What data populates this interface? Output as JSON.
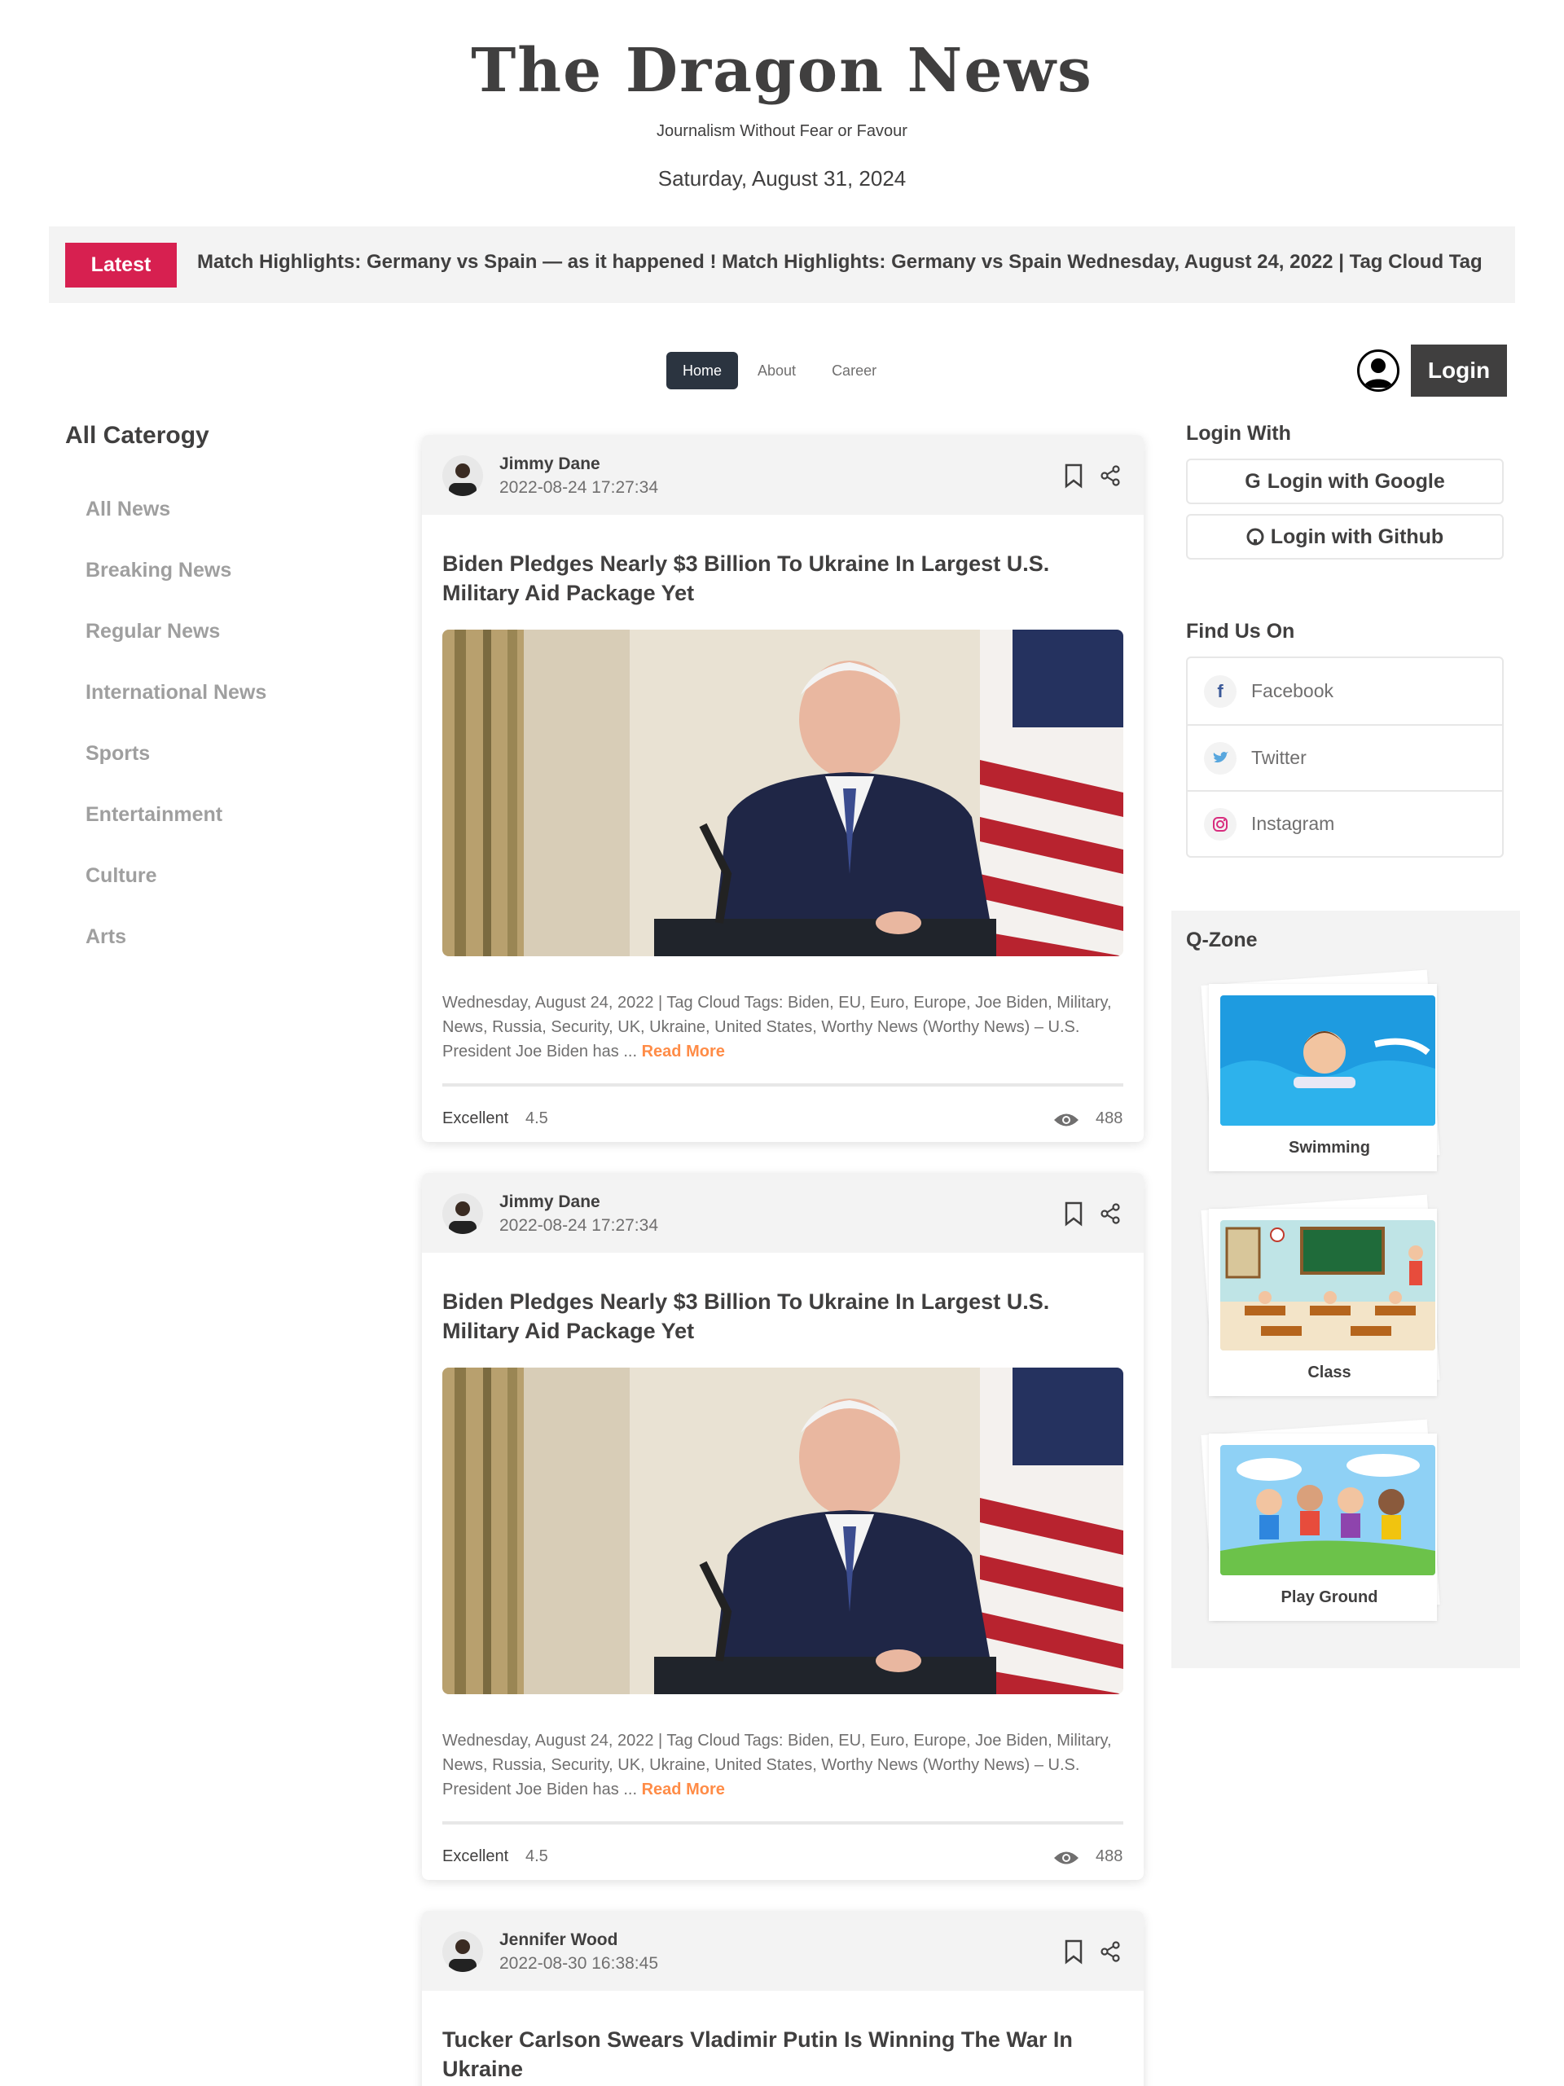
{
  "site": {
    "logo": "The Dragon News",
    "tagline": "Journalism Without Fear or Favour",
    "date": "Saturday, August 31, 2024"
  },
  "latest": {
    "badge": "Latest",
    "ticker": "Match Highlights: Germany vs Spain — as it happened ! Match Highlights: Germany vs Spain Wednesday, August 24, 2022 | Tag Cloud Tag"
  },
  "nav": {
    "items": [
      "Home",
      "About",
      "Career"
    ],
    "active": "Home",
    "login": "Login"
  },
  "categories": {
    "heading": "All Caterogy",
    "items": [
      "All News",
      "Breaking News",
      "Regular News",
      "International News",
      "Sports",
      "Entertainment",
      "Culture",
      "Arts"
    ]
  },
  "news": [
    {
      "author": "Jimmy Dane",
      "published": "2022-08-24 17:27:34",
      "title": "Biden Pledges Nearly $3 Billion To Ukraine In Largest U.S. Military Aid Package Yet",
      "excerpt": "Wednesday, August 24, 2022 | Tag Cloud Tags: Biden, EU, Euro, Europe, Joe Biden, Military, News, Russia, Security, UK, Ukraine, United States, Worthy News (Worthy News) – U.S. President Joe Biden has ...",
      "read_more": "Read More",
      "rating_label": "Excellent",
      "rating": "4.5",
      "views": "488"
    },
    {
      "author": "Jimmy Dane",
      "published": "2022-08-24 17:27:34",
      "title": "Biden Pledges Nearly $3 Billion To Ukraine In Largest U.S. Military Aid Package Yet",
      "excerpt": "Wednesday, August 24, 2022 | Tag Cloud Tags: Biden, EU, Euro, Europe, Joe Biden, Military, News, Russia, Security, UK, Ukraine, United States, Worthy News (Worthy News) – U.S. President Joe Biden has ...",
      "read_more": "Read More",
      "rating_label": "Excellent",
      "rating": "4.5",
      "views": "488"
    },
    {
      "author": "Jennifer Wood",
      "published": "2022-08-30 16:38:45",
      "title": "Tucker Carlson Swears Vladimir Putin Is Winning The War In Ukraine"
    }
  ],
  "login_with": {
    "heading": "Login With",
    "google": "Login with Google",
    "github": "Login with Github"
  },
  "find_us": {
    "heading": "Find Us On",
    "items": [
      "Facebook",
      "Twitter",
      "Instagram"
    ]
  },
  "qzone": {
    "heading": "Q-Zone",
    "items": [
      "Swimming",
      "Class",
      "Play Ground"
    ]
  },
  "colors": {
    "accent": "#d72050",
    "read_more": "#ff8c47",
    "dark": "#403f3f",
    "nav_active": "#2b3440"
  }
}
